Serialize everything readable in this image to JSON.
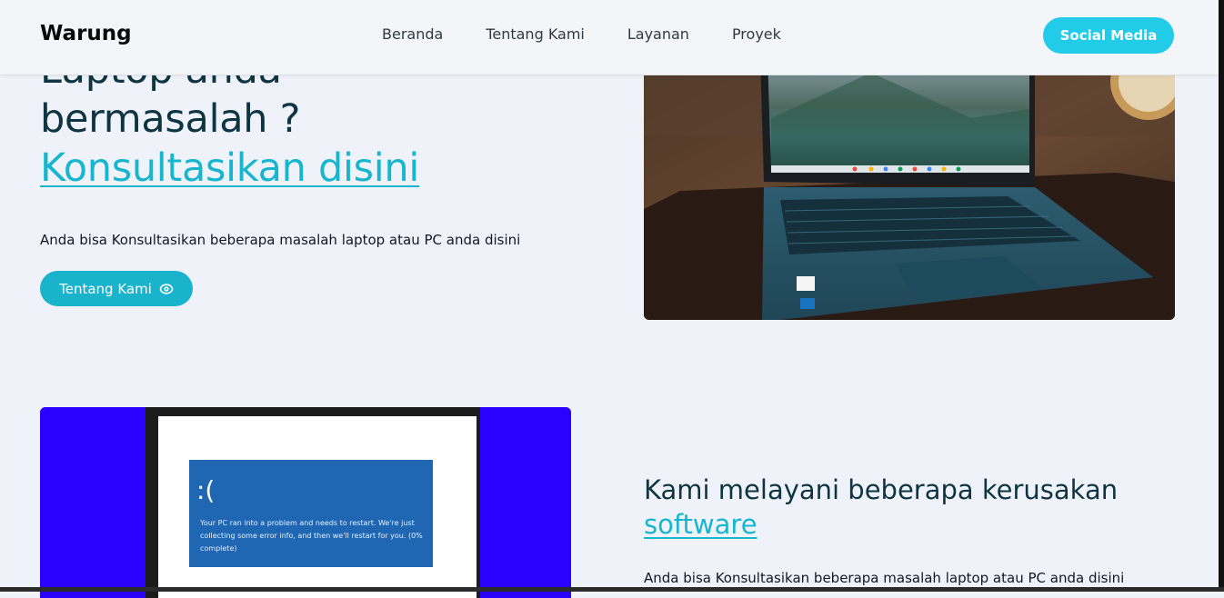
{
  "navbar": {
    "brand": "Warung",
    "links": [
      "Beranda",
      "Tentang Kami",
      "Layanan",
      "Proyek"
    ],
    "social_button": "Social Media"
  },
  "hero": {
    "title_line1": "Laptop anda",
    "title_line2": "bermasalah ?",
    "title_link": "Konsultasikan disini",
    "description": "Anda bisa Konsultasikan beberapa masalah laptop atau PC anda disini",
    "cta_label": "Tentang Kami",
    "cta_icon": "eye-icon"
  },
  "bsod": {
    "face": ":(",
    "message_line1": "Your PC ran into a problem and needs to restart. We're just",
    "message_line2": "collecting some error info, and then we'll restart for you. (0%",
    "message_line3": "complete)"
  },
  "services": {
    "title_line1": "Kami melayani beberapa kerusakan",
    "title_link": "software",
    "description": "Anda bisa Konsultasikan beberapa masalah laptop atau PC anda disini"
  },
  "colors": {
    "accent": "#18b5cf",
    "button": "#1ab3cc",
    "social_button": "#22cbe8",
    "heading": "#0f3542",
    "background": "#eff3f9"
  }
}
